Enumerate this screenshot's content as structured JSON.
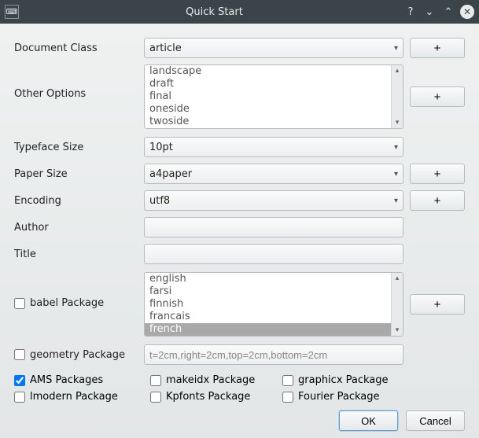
{
  "window": {
    "title": "Quick Start",
    "help": "?",
    "down": "⌄",
    "up": "⌃",
    "close": "✕"
  },
  "labels": {
    "document_class": "Document Class",
    "other_options": "Other Options",
    "typeface_size": "Typeface Size",
    "paper_size": "Paper Size",
    "encoding": "Encoding",
    "author": "Author",
    "title": "Title",
    "babel": "babel Package",
    "geometry": "geometry Package",
    "ams": "AMS Packages",
    "lmodern": "lmodern Package",
    "makeidx": "makeidx Package",
    "kpfonts": "Kpfonts Package",
    "graphicx": "graphicx Package",
    "fourier": "Fourier Package"
  },
  "values": {
    "document_class": "article",
    "typeface_size": "10pt",
    "paper_size": "a4paper",
    "encoding": "utf8",
    "author": "",
    "title": "",
    "geometry_text": "t=2cm,right=2cm,top=2cm,bottom=2cm",
    "ams_checked": true,
    "babel_checked": false,
    "geometry_checked": false,
    "lmodern_checked": false,
    "makeidx_checked": false,
    "kpfonts_checked": false,
    "graphicx_checked": false,
    "fourier_checked": false
  },
  "other_options": [
    "landscape",
    "draft",
    "final",
    "oneside",
    "twoside"
  ],
  "babel_langs": [
    "english",
    "farsi",
    "finnish",
    "francais",
    "french"
  ],
  "babel_selected": "french",
  "buttons": {
    "plus": "+",
    "ok": "OK",
    "cancel": "Cancel"
  }
}
